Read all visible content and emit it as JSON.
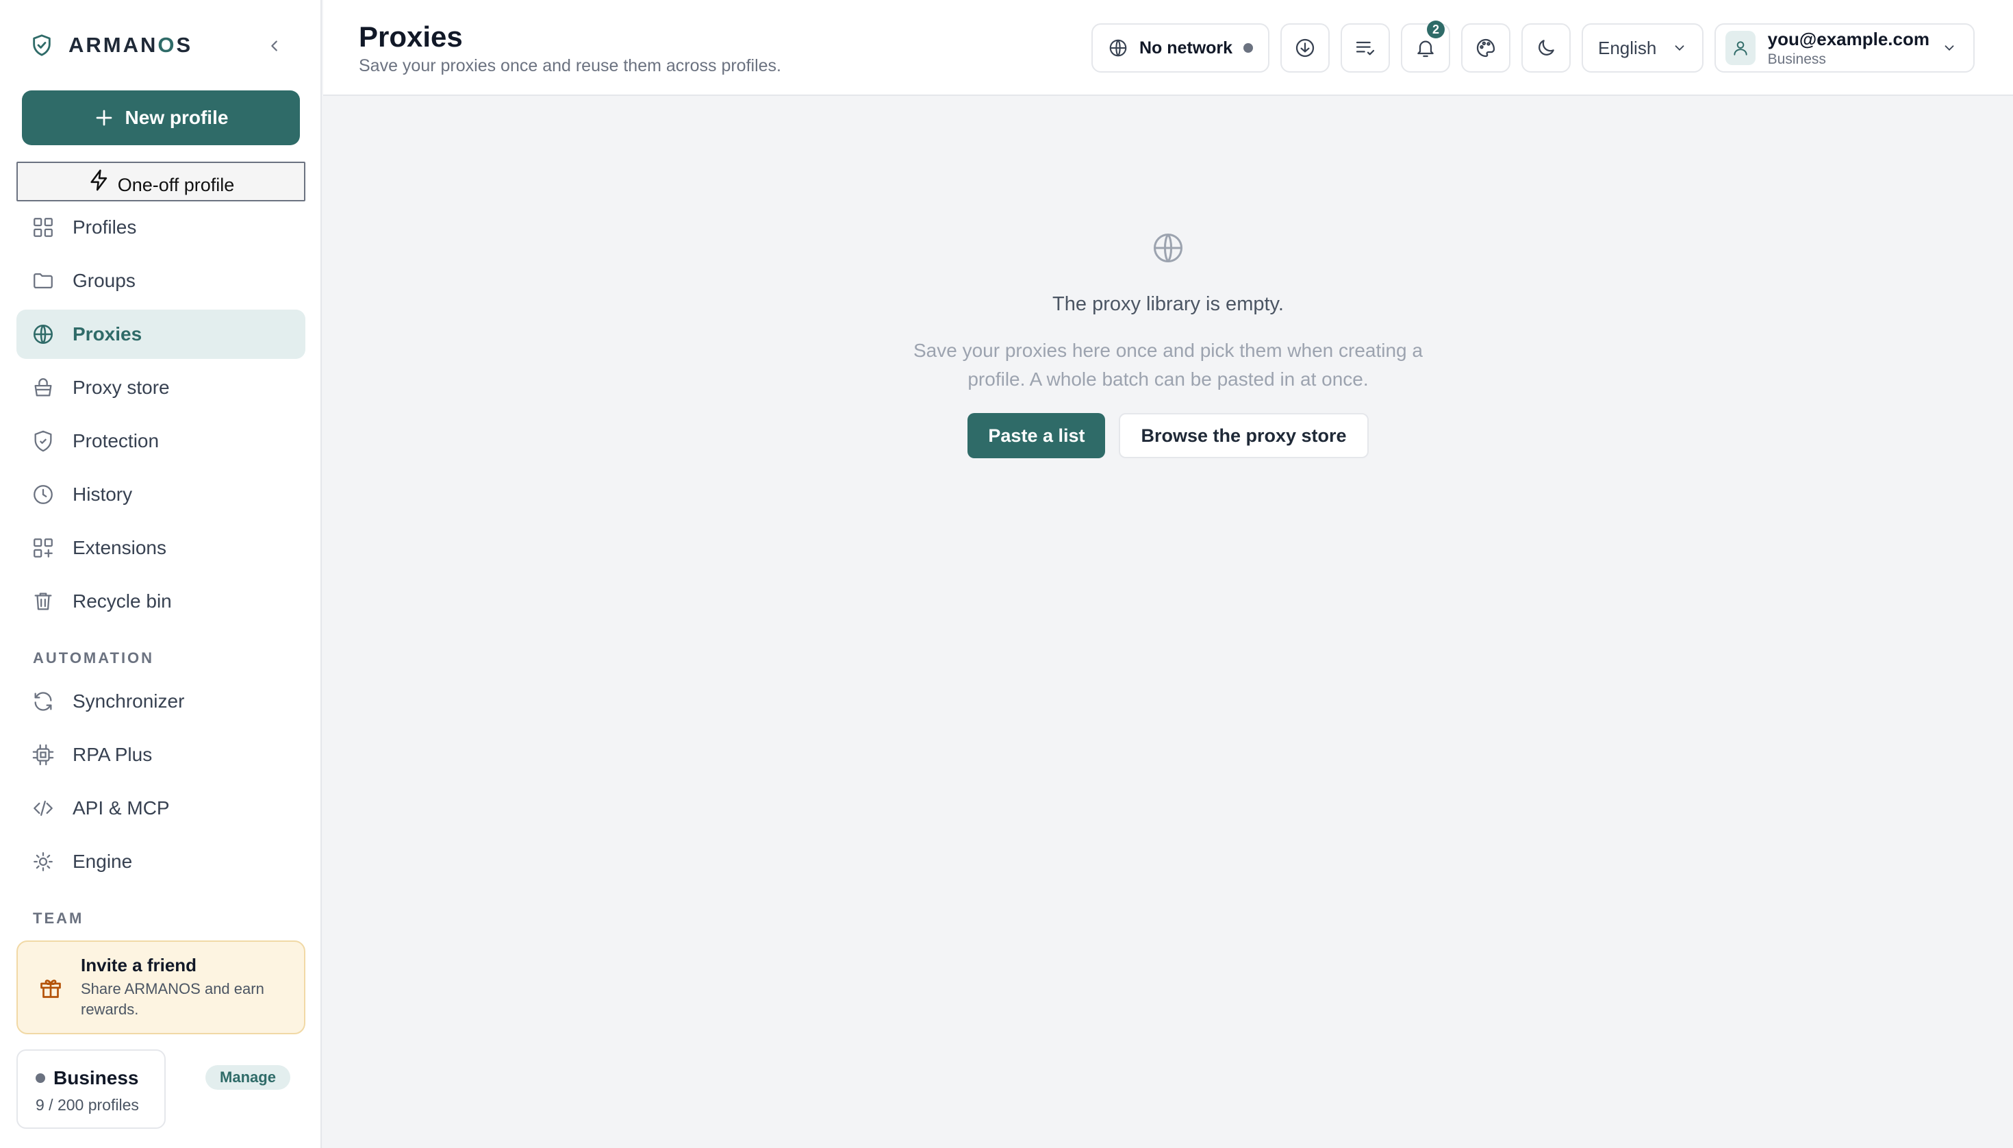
{
  "brand": {
    "name_main": "ARMAN",
    "name_accent": "O",
    "name_tail": "S"
  },
  "sidebar": {
    "new_profile_label": "New profile",
    "one_off_label": "One-off profile",
    "items": [
      {
        "label": "Profiles",
        "icon": "grid-icon"
      },
      {
        "label": "Groups",
        "icon": "folder-icon"
      },
      {
        "label": "Proxies",
        "icon": "globe-icon",
        "active": true
      },
      {
        "label": "Proxy store",
        "icon": "basket-icon"
      },
      {
        "label": "Protection",
        "icon": "shield-icon"
      },
      {
        "label": "History",
        "icon": "clock-icon"
      },
      {
        "label": "Extensions",
        "icon": "extensions-icon"
      },
      {
        "label": "Recycle bin",
        "icon": "trash-icon"
      }
    ],
    "automation_label": "AUTOMATION",
    "automation_items": [
      {
        "label": "Synchronizer",
        "icon": "sync-icon"
      },
      {
        "label": "RPA Plus",
        "icon": "chip-icon"
      },
      {
        "label": "API & MCP",
        "icon": "code-icon"
      },
      {
        "label": "Engine",
        "icon": "sun-icon"
      }
    ],
    "team_label": "TEAM",
    "invite": {
      "title": "Invite a friend",
      "subtitle": "Share ARMANOS and earn rewards."
    },
    "plan": {
      "name": "Business",
      "count": "9 / 200 profiles",
      "manage_label": "Manage"
    }
  },
  "header": {
    "title": "Proxies",
    "subtitle": "Save your proxies once and reuse them across profiles.",
    "network_label": "No network",
    "notifications_count": "2",
    "language": "English",
    "user_email": "you@example.com",
    "user_plan": "Business"
  },
  "main": {
    "empty_title": "The proxy library is empty.",
    "empty_description": "Save your proxies here once and pick them when creating a profile. A whole batch can be pasted in at once.",
    "paste_label": "Paste a list",
    "browse_label": "Browse the proxy store"
  },
  "colors": {
    "accent": "#2f6b68",
    "accent_soft": "#e3eeee",
    "invite_bg": "#fdf4e1"
  }
}
